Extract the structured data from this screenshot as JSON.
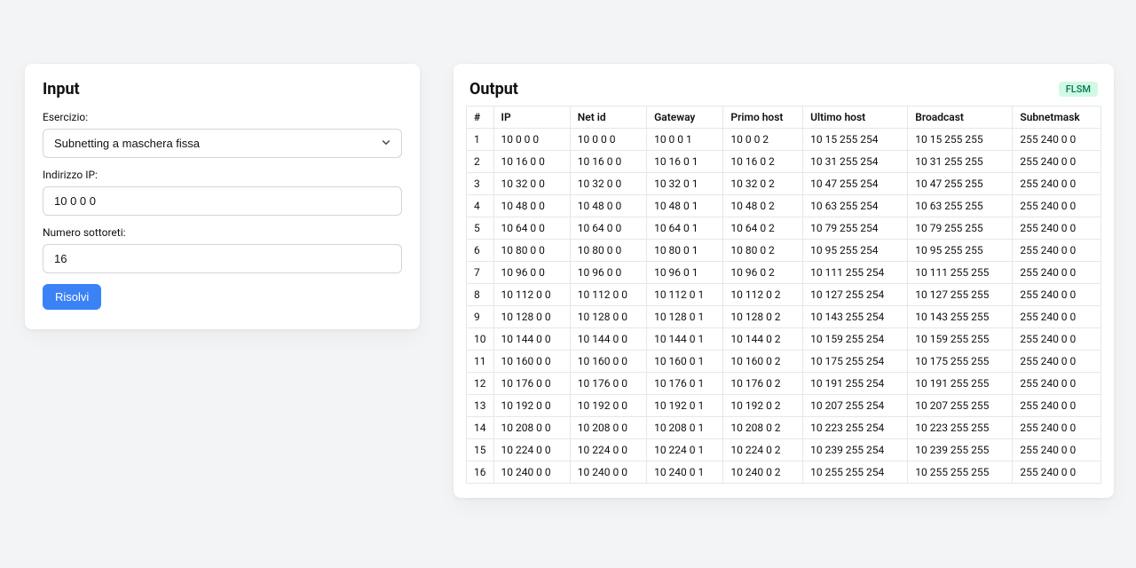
{
  "input": {
    "title": "Input",
    "exercise_label": "Esercizio:",
    "exercise_value": "Subnetting a maschera fissa",
    "ip_label": "Indirizzo IP:",
    "ip_value": "10 0 0 0",
    "subnets_label": "Numero sottoreti:",
    "subnets_value": "16",
    "solve_label": "Risolvi"
  },
  "output": {
    "title": "Output",
    "badge": "FLSM",
    "columns": [
      "#",
      "IP",
      "Net id",
      "Gateway",
      "Primo host",
      "Ultimo host",
      "Broadcast",
      "Subnetmask"
    ],
    "rows": [
      {
        "n": 1,
        "ip": "10 0 0 0",
        "netid": "10 0 0 0",
        "gw": "10 0 0 1",
        "first": "10 0 0 2",
        "last": "10 15 255 254",
        "bc": "10 15 255 255",
        "mask": "255 240 0 0"
      },
      {
        "n": 2,
        "ip": "10 16 0 0",
        "netid": "10 16 0 0",
        "gw": "10 16 0 1",
        "first": "10 16 0 2",
        "last": "10 31 255 254",
        "bc": "10 31 255 255",
        "mask": "255 240 0 0"
      },
      {
        "n": 3,
        "ip": "10 32 0 0",
        "netid": "10 32 0 0",
        "gw": "10 32 0 1",
        "first": "10 32 0 2",
        "last": "10 47 255 254",
        "bc": "10 47 255 255",
        "mask": "255 240 0 0"
      },
      {
        "n": 4,
        "ip": "10 48 0 0",
        "netid": "10 48 0 0",
        "gw": "10 48 0 1",
        "first": "10 48 0 2",
        "last": "10 63 255 254",
        "bc": "10 63 255 255",
        "mask": "255 240 0 0"
      },
      {
        "n": 5,
        "ip": "10 64 0 0",
        "netid": "10 64 0 0",
        "gw": "10 64 0 1",
        "first": "10 64 0 2",
        "last": "10 79 255 254",
        "bc": "10 79 255 255",
        "mask": "255 240 0 0"
      },
      {
        "n": 6,
        "ip": "10 80 0 0",
        "netid": "10 80 0 0",
        "gw": "10 80 0 1",
        "first": "10 80 0 2",
        "last": "10 95 255 254",
        "bc": "10 95 255 255",
        "mask": "255 240 0 0"
      },
      {
        "n": 7,
        "ip": "10 96 0 0",
        "netid": "10 96 0 0",
        "gw": "10 96 0 1",
        "first": "10 96 0 2",
        "last": "10 111 255 254",
        "bc": "10 111 255 255",
        "mask": "255 240 0 0"
      },
      {
        "n": 8,
        "ip": "10 112 0 0",
        "netid": "10 112 0 0",
        "gw": "10 112 0 1",
        "first": "10 112 0 2",
        "last": "10 127 255 254",
        "bc": "10 127 255 255",
        "mask": "255 240 0 0"
      },
      {
        "n": 9,
        "ip": "10 128 0 0",
        "netid": "10 128 0 0",
        "gw": "10 128 0 1",
        "first": "10 128 0 2",
        "last": "10 143 255 254",
        "bc": "10 143 255 255",
        "mask": "255 240 0 0"
      },
      {
        "n": 10,
        "ip": "10 144 0 0",
        "netid": "10 144 0 0",
        "gw": "10 144 0 1",
        "first": "10 144 0 2",
        "last": "10 159 255 254",
        "bc": "10 159 255 255",
        "mask": "255 240 0 0"
      },
      {
        "n": 11,
        "ip": "10 160 0 0",
        "netid": "10 160 0 0",
        "gw": "10 160 0 1",
        "first": "10 160 0 2",
        "last": "10 175 255 254",
        "bc": "10 175 255 255",
        "mask": "255 240 0 0"
      },
      {
        "n": 12,
        "ip": "10 176 0 0",
        "netid": "10 176 0 0",
        "gw": "10 176 0 1",
        "first": "10 176 0 2",
        "last": "10 191 255 254",
        "bc": "10 191 255 255",
        "mask": "255 240 0 0"
      },
      {
        "n": 13,
        "ip": "10 192 0 0",
        "netid": "10 192 0 0",
        "gw": "10 192 0 1",
        "first": "10 192 0 2",
        "last": "10 207 255 254",
        "bc": "10 207 255 255",
        "mask": "255 240 0 0"
      },
      {
        "n": 14,
        "ip": "10 208 0 0",
        "netid": "10 208 0 0",
        "gw": "10 208 0 1",
        "first": "10 208 0 2",
        "last": "10 223 255 254",
        "bc": "10 223 255 255",
        "mask": "255 240 0 0"
      },
      {
        "n": 15,
        "ip": "10 224 0 0",
        "netid": "10 224 0 0",
        "gw": "10 224 0 1",
        "first": "10 224 0 2",
        "last": "10 239 255 254",
        "bc": "10 239 255 255",
        "mask": "255 240 0 0"
      },
      {
        "n": 16,
        "ip": "10 240 0 0",
        "netid": "10 240 0 0",
        "gw": "10 240 0 1",
        "first": "10 240 0 2",
        "last": "10 255 255 254",
        "bc": "10 255 255 255",
        "mask": "255 240 0 0"
      }
    ]
  }
}
